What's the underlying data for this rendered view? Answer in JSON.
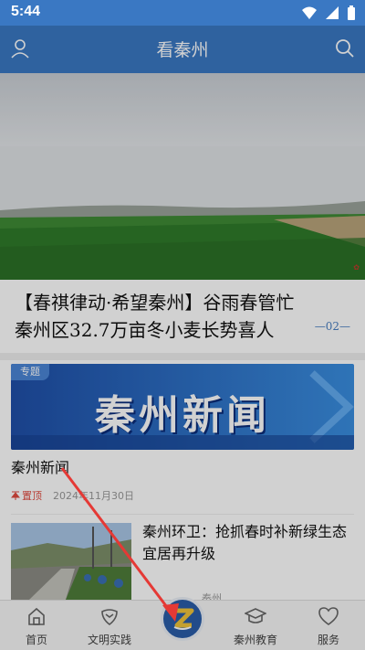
{
  "status_bar": {
    "time": "5:44"
  },
  "header": {
    "title": "看秦州",
    "user_icon": "user-icon",
    "search_icon": "search-icon"
  },
  "headline": {
    "text": "【春祺律动·希望秦州】谷雨春管忙秦州区32.7万亩冬小麦长势喜人",
    "indicator": "—02—"
  },
  "topic": {
    "tag": "专题",
    "banner_text": "秦州新闻",
    "title": "秦州新闻",
    "pin_label": "置顶",
    "date": "2024年11月30日"
  },
  "news": {
    "title": "秦州环卫：抢抓春时补新绿生态宜居再升级",
    "source": "…秦州…"
  },
  "bottom_nav": {
    "items": [
      {
        "label": "首页",
        "icon": "home-icon"
      },
      {
        "label": "文明实践",
        "icon": "heart-hands-icon"
      },
      {
        "label": "",
        "icon": "z-logo-icon"
      },
      {
        "label": "秦州教育",
        "icon": "graduation-cap-icon"
      },
      {
        "label": "服务",
        "icon": "heart-icon"
      }
    ]
  },
  "colors": {
    "header_bg": "#3a78c3",
    "accent_red": "#e04a3f",
    "annotation_arrow": "#e53935"
  }
}
